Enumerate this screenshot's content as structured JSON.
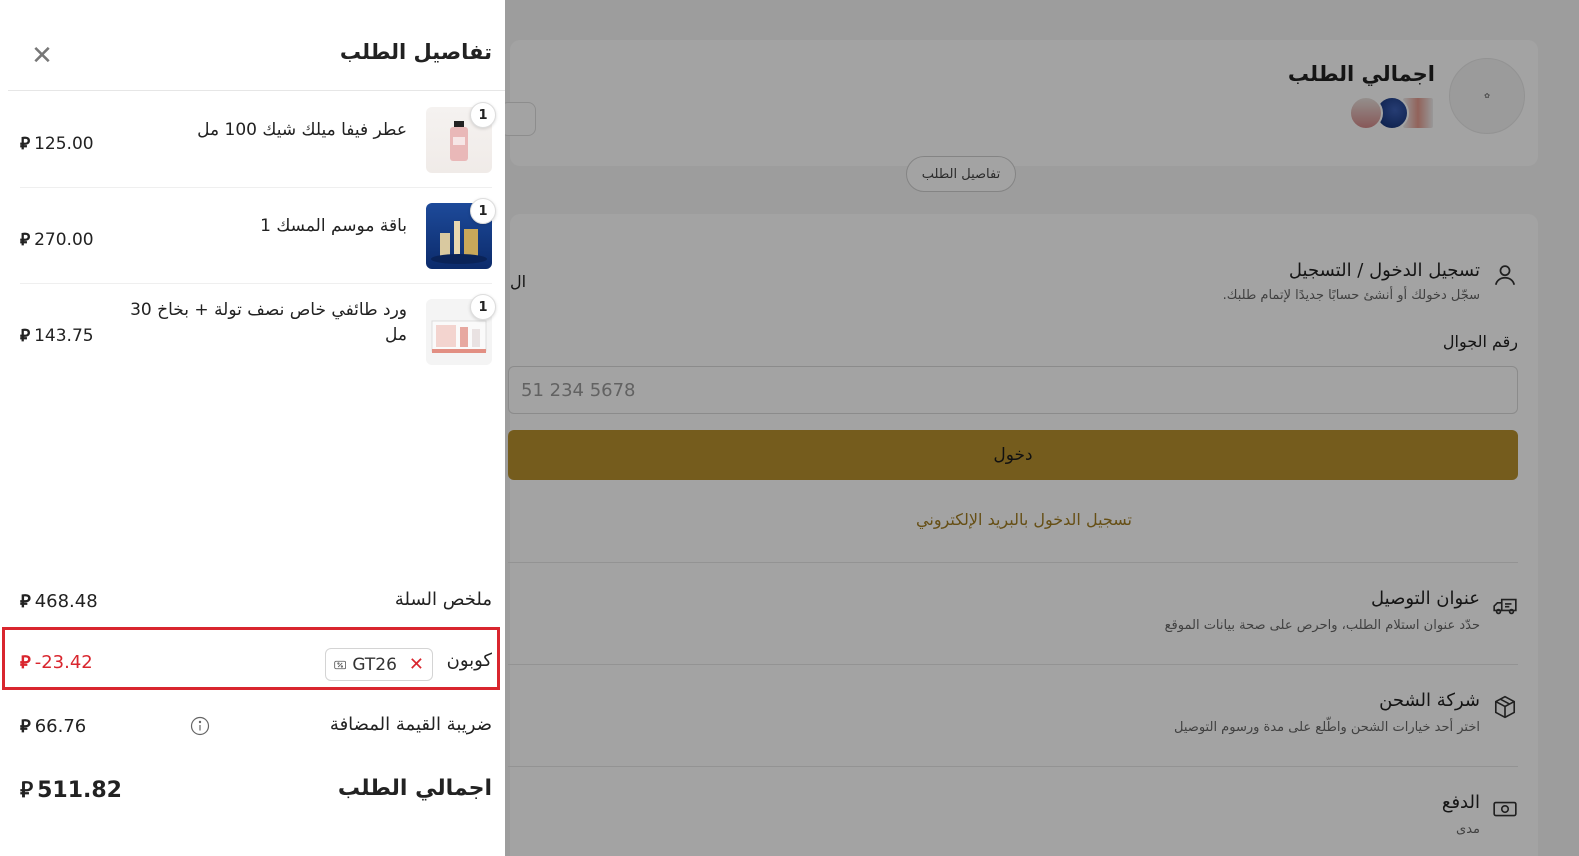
{
  "background": {
    "summary_title": "اجمالي الطلب",
    "order_details_button": "تفاصيل الطلب",
    "login": {
      "title": "تسجيل الدخول / التسجيل",
      "subtitle": "سجّل دخولك أو أنشئ حسابًا جديدًا لإتمام طلبك.",
      "phone_label": "رقم الجوال",
      "phone_placeholder": "51 234 5678",
      "login_button": "دخول",
      "email_link": "تسجيل الدخول بالبريد الإلكتروني"
    },
    "shipping_address": {
      "title": "عنوان التوصيل",
      "subtitle": "حدّد عنوان استلام الطلب، واحرص على صحة بيانات الموقع"
    },
    "shipping_company": {
      "title": "شركة الشحن",
      "subtitle": "اختر أحد خيارات الشحن واطّلع على مدة ورسوم التوصيل"
    },
    "payment": {
      "title": "الدفع",
      "subtitle": "مدى"
    },
    "cut_text": "ال"
  },
  "drawer": {
    "title": "تفاصيل الطلب",
    "close_icon": "close-icon",
    "currency_symbol": "⃁",
    "items": [
      {
        "qty": "1",
        "name": "عطر فيفا ميلك شيك 100 مل",
        "price": "125.00"
      },
      {
        "qty": "1",
        "name": "باقة موسم المسك 1",
        "price": "270.00"
      },
      {
        "qty": "1",
        "name": "ورد طائفي خاص نصف تولة + بخاخ 30 مل",
        "price": "143.75"
      }
    ],
    "subtotal": {
      "label": "ملخص السلة",
      "value": "468.48"
    },
    "coupon": {
      "label": "كوبون",
      "code": "GT26",
      "value": "-23.42"
    },
    "vat": {
      "label": "ضريبة القيمة المضافة",
      "value": "66.76"
    },
    "total": {
      "label": "اجمالي الطلب",
      "value": "511.82"
    }
  },
  "colors": {
    "accent_gold": "#b8912e",
    "coupon_red": "#d9262e"
  }
}
